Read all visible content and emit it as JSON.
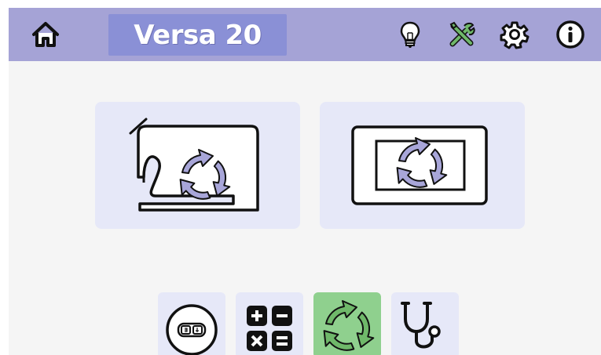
{
  "header": {
    "title": "Versa 20",
    "background": "#a5a3d6",
    "title_background": "#8a90d6",
    "icons": [
      "home-icon",
      "lightbulb-icon",
      "tools-icon",
      "gear-icon",
      "info-icon"
    ]
  },
  "main": {
    "cards": [
      {
        "icon": "sewing-machine-update-icon"
      },
      {
        "icon": "screen-update-icon"
      }
    ]
  },
  "bottom_nav": {
    "tiles": [
      {
        "icon": "thread-counter-icon",
        "active": false
      },
      {
        "icon": "calculator-icon",
        "active": false
      },
      {
        "icon": "update-icon",
        "active": true
      },
      {
        "icon": "stethoscope-icon",
        "active": false
      }
    ],
    "active_color": "#8fd08e",
    "tile_color": "#e6e8f8"
  },
  "colors": {
    "arrow_fill": "#a8a6d9",
    "icon_green": "#6fb86a"
  }
}
